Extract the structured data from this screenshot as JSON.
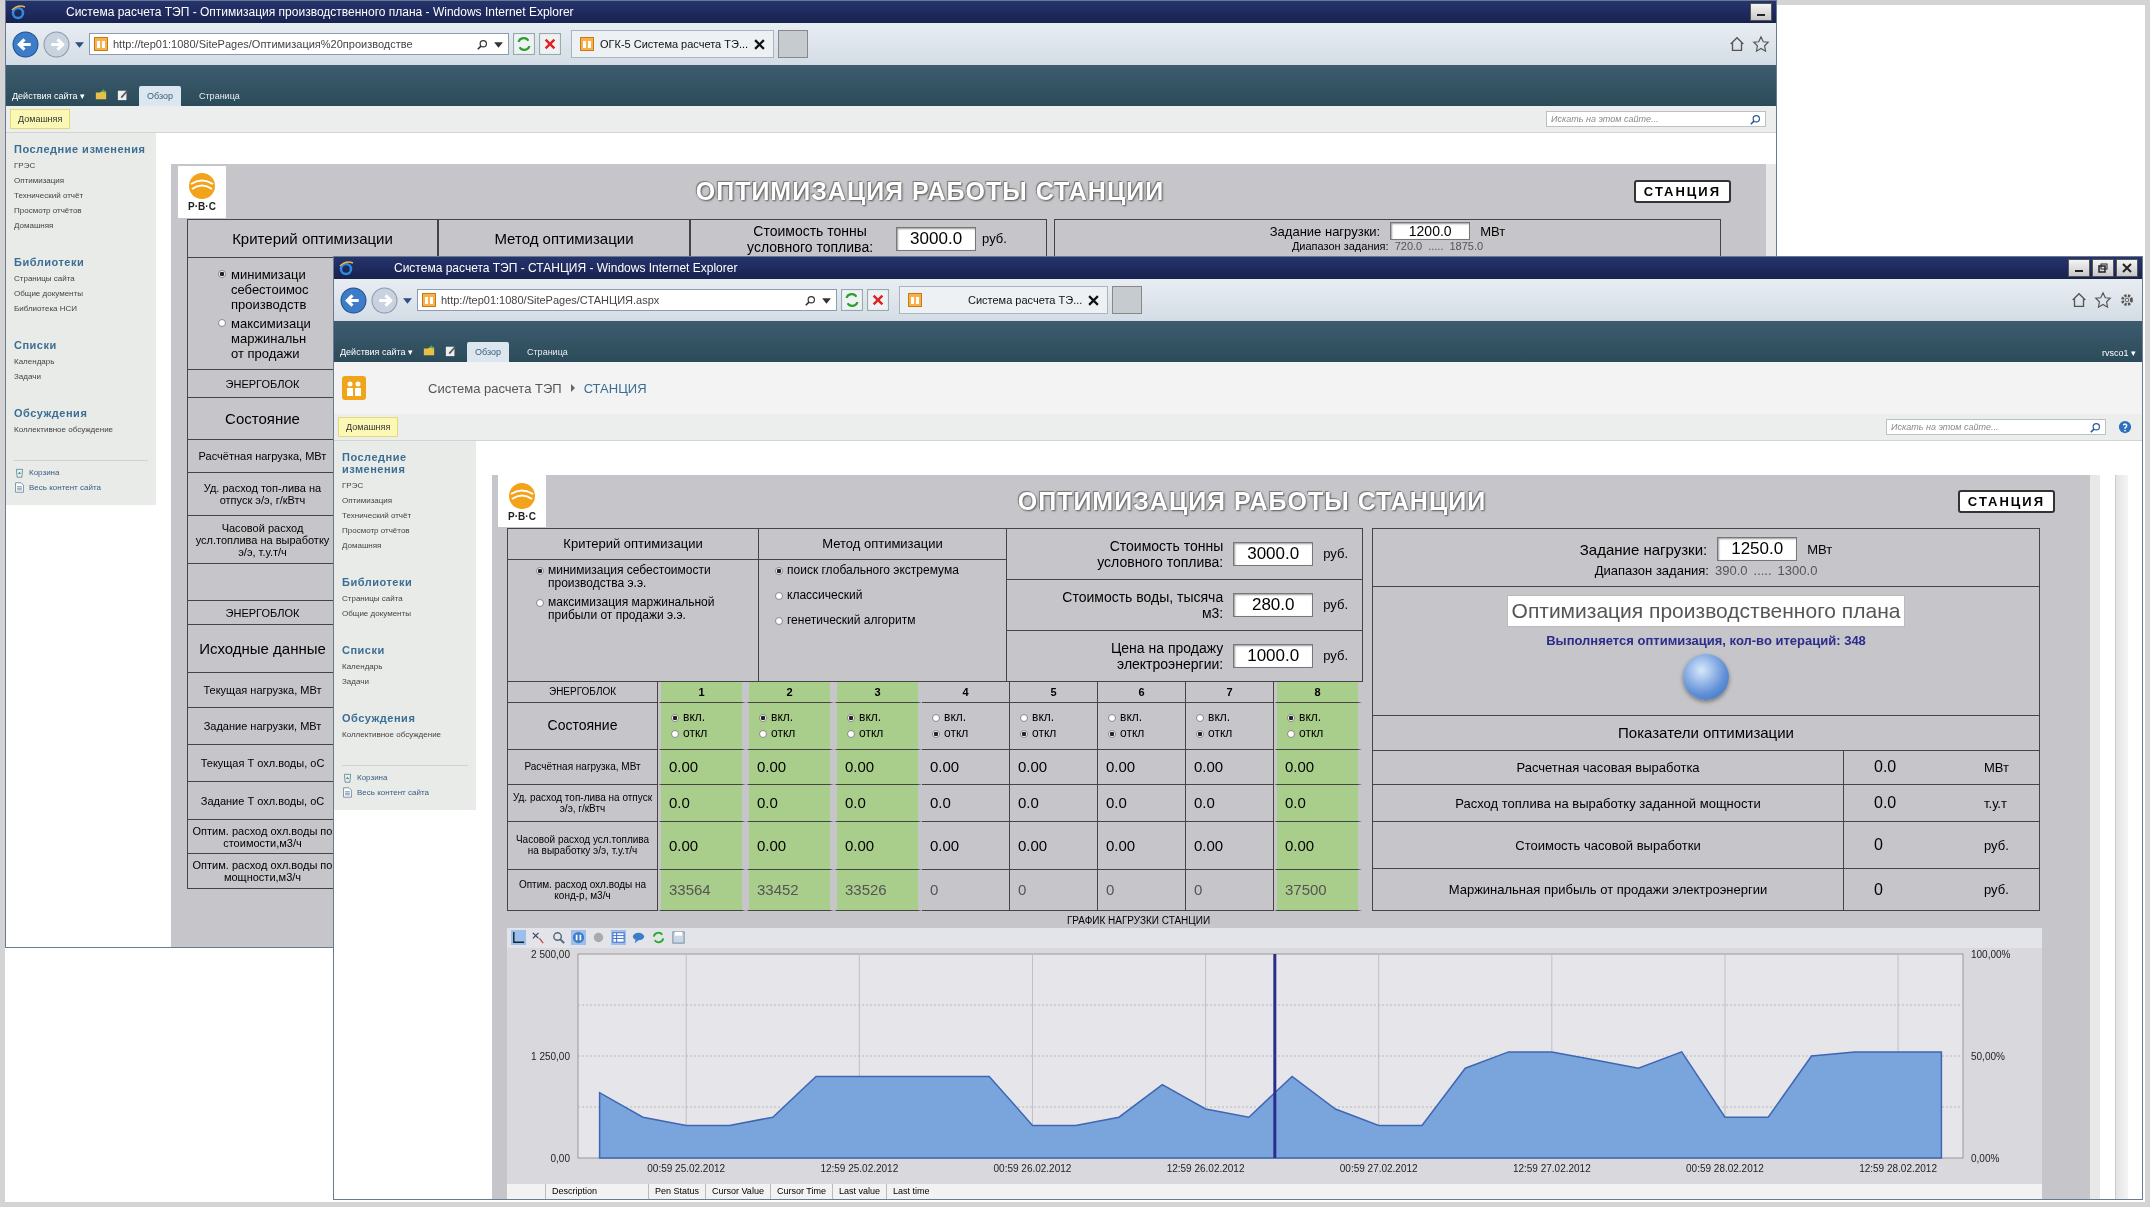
{
  "back_window": {
    "title": "Система расчета ТЭП - Оптимизация производственного плана - Windows Internet Explorer",
    "address": "http://tep01:1080/SitePages/Оптимизация%20производстве",
    "tab": "ОГК-5 Система расчета ТЭ...",
    "ribbon": {
      "actions": "Действия сайта ▾",
      "tabs": [
        {
          "label": "Обзор",
          "selected": true
        },
        {
          "label": "Страница",
          "selected": false
        }
      ]
    },
    "home_tab": "Домашняя",
    "search": {
      "placeholder": "Искать на этом сайте..."
    },
    "sidebar": [
      {
        "heading": "Последние изменения",
        "items": [
          "ГРЭС",
          "Оптимизация",
          "Технический отчёт",
          "Просмотр отчётов",
          "Домашняя"
        ]
      },
      {
        "heading": "Библиотеки",
        "items": [
          "Страницы сайта",
          "Общие документы",
          "Библиотека НСИ"
        ]
      },
      {
        "heading": "Списки",
        "items": [
          "Календарь",
          "Задачи"
        ]
      },
      {
        "heading": "Обсуждения",
        "items": [
          "Коллективное обсуждение"
        ]
      }
    ],
    "sidebar_links": [
      "Корзина",
      "Весь контент сайта"
    ],
    "panel": {
      "logo": "Р·В·С",
      "title": "ОПТИМИЗАЦИЯ РАБОТЫ СТАНЦИИ",
      "station_button": "СТАНЦИЯ",
      "header": {
        "criterion": "Критерий оптимизации",
        "method": "Метод оптимизации",
        "fuel_cost_label": "Стоимость тонны условного топлива:",
        "fuel_cost": "3000.0",
        "fuel_cost_unit": "руб.",
        "load_task_label": "Задание нагрузки:",
        "load_task": "1200.0",
        "load_task_unit": "МВт",
        "range_label": "Диапазон задания:",
        "range_from": "720.0",
        "range_sep": ".....",
        "range_to": "1875.0"
      },
      "criteria": [
        {
          "lines": [
            "минимизаци",
            "себестоимос",
            "производств"
          ],
          "selected": true
        },
        {
          "lines": [
            "максимизаци",
            "маржинальн",
            "от продажи"
          ],
          "selected": false
        }
      ],
      "rows": [
        {
          "kind": "header",
          "label": "ЭНЕРГОБЛОК"
        },
        {
          "kind": "big",
          "label": "Состояние"
        },
        {
          "kind": "label",
          "label": "Расчётная нагрузка, МВт"
        },
        {
          "kind": "label",
          "label": "Уд. расход топ-лива на отпуск э/э, г/кВтч"
        },
        {
          "kind": "label",
          "label": "Часовой расход усл.топлива на выработку э/э, т.у.т/ч"
        },
        {
          "kind": "spacer"
        },
        {
          "kind": "header",
          "label": "ЭНЕРГОБЛОК"
        },
        {
          "kind": "big",
          "label": "Исходные данные"
        },
        {
          "kind": "label",
          "label": "Текущая нагрузка, МВт"
        },
        {
          "kind": "label",
          "label": "Задание нагрузки, МВт"
        },
        {
          "kind": "label",
          "label": "Текущая Т охл.воды, оС"
        },
        {
          "kind": "label",
          "label": "Задание Т охл.воды, оС"
        },
        {
          "kind": "label",
          "label": "Оптим. расход охл.воды по стоимости,м3/ч"
        },
        {
          "kind": "label",
          "label": "Оптим. расход охл.воды по мощности,м3/ч"
        }
      ]
    }
  },
  "front_window": {
    "title": "Система расчета ТЭП - СТАНЦИЯ - Windows Internet Explorer",
    "address": "http://tep01:1080/SitePages/СТАНЦИЯ.aspx",
    "tab": "Система расчета ТЭ...",
    "ribbon": {
      "actions": "Действия сайта ▾",
      "tabs": [
        {
          "label": "Обзор",
          "selected": true
        },
        {
          "label": "Страница",
          "selected": false
        }
      ],
      "user": "rvsco1 ▾"
    },
    "breadcrumb": {
      "site": "Система расчета ТЭП",
      "page": "СТАНЦИЯ"
    },
    "home_tab": "Домашняя",
    "search": {
      "placeholder": "Искать на этом сайте..."
    },
    "sidebar": [
      {
        "heading": "Последние изменения",
        "items": [
          "ГРЭС",
          "Оптимизация",
          "Технический отчёт",
          "Просмотр отчётов",
          "Домашняя"
        ]
      },
      {
        "heading": "Библиотеки",
        "items": [
          "Страницы сайта",
          "Общие документы"
        ]
      },
      {
        "heading": "Списки",
        "items": [
          "Календарь",
          "Задачи"
        ]
      },
      {
        "heading": "Обсуждения",
        "items": [
          "Коллективное обсуждение"
        ]
      }
    ],
    "sidebar_links": [
      "Корзина",
      "Весь контент сайта"
    ],
    "panel": {
      "logo": "Р·В·С",
      "title": "ОПТИМИЗАЦИЯ РАБОТЫ СТАНЦИИ",
      "station_button": "СТАНЦИЯ",
      "criterion": {
        "heading": "Критерий оптимизации",
        "options": [
          {
            "label": "минимизация себестоимости производства э.э.",
            "selected": true
          },
          {
            "label": "максимизация маржинальной прибыли от продажи э.э.",
            "selected": false
          }
        ]
      },
      "method": {
        "heading": "Метод оптимизации",
        "options": [
          {
            "label": "поиск глобального экстремума",
            "selected": true
          },
          {
            "label": "классический",
            "selected": false
          },
          {
            "label": "генетический алгоритм",
            "selected": false
          }
        ]
      },
      "prices": [
        {
          "label": "Стоимость тонны условного топлива:",
          "value": "3000.0",
          "unit": "руб."
        },
        {
          "label": "Стоимость воды, тысяча м3:",
          "value": "280.0",
          "unit": "руб."
        },
        {
          "label": "Цена на продажу электроэнергии:",
          "value": "1000.0",
          "unit": "руб."
        }
      ],
      "load_task": {
        "label": "Задание нагрузки:",
        "value": "1250.0",
        "unit": "МВт",
        "range_label": "Диапазон задания:",
        "range_from": "390.0",
        "range_sep": ".....",
        "range_to": "1300.0"
      },
      "optimization": {
        "title": "Оптимизация производственного плана",
        "status_label": "Выполняется оптимизация, кол-во итераций:",
        "iterations": "348"
      },
      "units_label": "ЭНЕРГОБЛОК",
      "state_label": "Состояние",
      "row_labels": [
        "Расчётная нагрузка, МВт",
        "Уд. расход топ-лива на отпуск э/э, г/кВтч",
        "Часовой расход усл.топлива на выработку э/э, т.у.т/ч",
        "Оптим. расход охл.воды на конд-р, м3/ч"
      ],
      "units": [
        {
          "number": "1",
          "on": true,
          "on_label": "вкл.",
          "off_label": "откл",
          "values": [
            "0.00",
            "0.0",
            "0.00",
            "33564"
          ]
        },
        {
          "number": "2",
          "on": true,
          "on_label": "вкл.",
          "off_label": "откл",
          "values": [
            "0.00",
            "0.0",
            "0.00",
            "33452"
          ]
        },
        {
          "number": "3",
          "on": true,
          "on_label": "вкл.",
          "off_label": "откл",
          "values": [
            "0.00",
            "0.0",
            "0.00",
            "33526"
          ]
        },
        {
          "number": "4",
          "on": false,
          "on_label": "вкл.",
          "off_label": "откл",
          "values": [
            "0.00",
            "0.0",
            "0.00",
            "0"
          ]
        },
        {
          "number": "5",
          "on": false,
          "on_label": "вкл.",
          "off_label": "откл",
          "values": [
            "0.00",
            "0.0",
            "0.00",
            "0"
          ]
        },
        {
          "number": "6",
          "on": false,
          "on_label": "вкл.",
          "off_label": "откл",
          "values": [
            "0.00",
            "0.0",
            "0.00",
            "0"
          ]
        },
        {
          "number": "7",
          "on": false,
          "on_label": "вкл.",
          "off_label": "откл",
          "values": [
            "0.00",
            "0.0",
            "0.00",
            "0"
          ]
        },
        {
          "number": "8",
          "on": true,
          "on_label": "вкл.",
          "off_label": "откл",
          "values": [
            "0.00",
            "0.0",
            "0.00",
            "37500"
          ]
        }
      ],
      "indicators": {
        "title": "Показатели оптимизации",
        "rows": [
          {
            "label": "Расчетная часовая выработка",
            "value": "0.0",
            "unit": "МВт"
          },
          {
            "label": "Расход топлива на выработку заданной мощности",
            "value": "0.0",
            "unit": "т.у.т"
          },
          {
            "label": "Стоимость часовой выработки",
            "value": "0",
            "unit": "руб."
          },
          {
            "label": "Маржинальная прибыль от продажи электроэнергии",
            "value": "0",
            "unit": "руб."
          }
        ]
      },
      "chart": {
        "right_axis_labels": [
          "100,00%",
          "50,00%",
          "0,00%"
        ],
        "legend_columns": [
          "Description",
          "Pen Status",
          "Cursor Value",
          "Cursor Time",
          "Last value",
          "Last time"
        ],
        "chart_data": {
          "type": "area",
          "title": "ГРАФИК НАГРУЗКИ СТАНЦИИ",
          "categories": [
            null,
            null,
            "00:59 25.02.2012",
            null,
            null,
            null,
            "12:59 25.02.2012",
            null,
            null,
            null,
            "00:59 26.02.2012",
            null,
            null,
            null,
            "12:59 26.02.2012",
            null,
            null,
            null,
            "00:59 27.02.2012",
            null,
            null,
            null,
            "12:59 27.02.2012",
            null,
            null,
            null,
            "00:59 28.02.2012",
            null,
            null,
            null,
            "12:59 28.02.2012",
            null
          ],
          "series": [
            {
              "color": "#7aa5dc",
              "values": [
                800,
                500,
                400,
                400,
                500,
                1000,
                1000,
                1000,
                1000,
                1000,
                400,
                400,
                500,
                900,
                600,
                500,
                1000,
                600,
                400,
                400,
                1100,
                1300,
                1300,
                1200,
                1100,
                1300,
                500,
                500,
                1250,
                1300,
                1300,
                1300
              ]
            }
          ],
          "ylim": [
            0,
            2500
          ],
          "grid": true,
          "yticks": [
            {
              "value": 0,
              "label": "0,00"
            },
            {
              "value": 1250,
              "label": "1 250,00"
            },
            {
              "value": 2500,
              "label": "2 500,00"
            }
          ]
        }
      }
    }
  }
}
